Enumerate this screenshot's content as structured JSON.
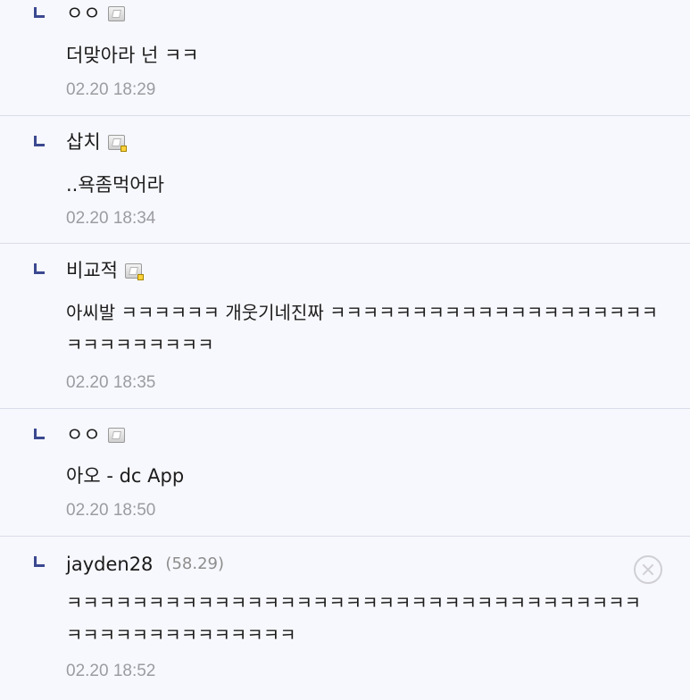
{
  "comments": [
    {
      "nickname": "ㅇㅇ",
      "ip": "",
      "text": "더맞아라 넌 ㅋㅋ",
      "time": "02.20 18:29",
      "icon": "gallog-icon"
    },
    {
      "nickname": "삽치",
      "ip": "",
      "text": "..욕좀먹어라",
      "time": "02.20 18:34",
      "icon": "gallog-icon-sub"
    },
    {
      "nickname": "비교적",
      "ip": "",
      "text": "아씨발 ㅋㅋㅋㅋㅋㅋ 개웃기네진짜 ㅋㅋㅋㅋㅋㅋㅋㅋㅋㅋㅋㅋㅋㅋㅋㅋㅋㅋㅋㅋㅋㅋㅋㅋㅋㅋㅋㅋㅋ",
      "time": "02.20 18:35",
      "icon": "gallog-icon-sub"
    },
    {
      "nickname": "ㅇㅇ",
      "ip": "",
      "text": "아오 - dc App",
      "time": "02.20 18:50",
      "icon": "gallog-icon"
    },
    {
      "nickname": "jayden28",
      "ip": "(58.29)",
      "text": "ㅋㅋㅋㅋㅋㅋㅋㅋㅋㅋㅋㅋㅋㅋㅋㅋㅋㅋㅋㅋㅋㅋㅋㅋㅋㅋㅋㅋㅋㅋㅋㅋㅋㅋㅋㅋㅋㅋㅋㅋㅋㅋㅋㅋㅋㅋㅋㅋㅋ",
      "time": "02.20 18:52",
      "icon": "delete-icon"
    }
  ],
  "colors": {
    "background": "#f7f8fd",
    "reply_arrow": "#3b4890",
    "timestamp": "#9b9ba2",
    "divider": "#d9dde8"
  }
}
